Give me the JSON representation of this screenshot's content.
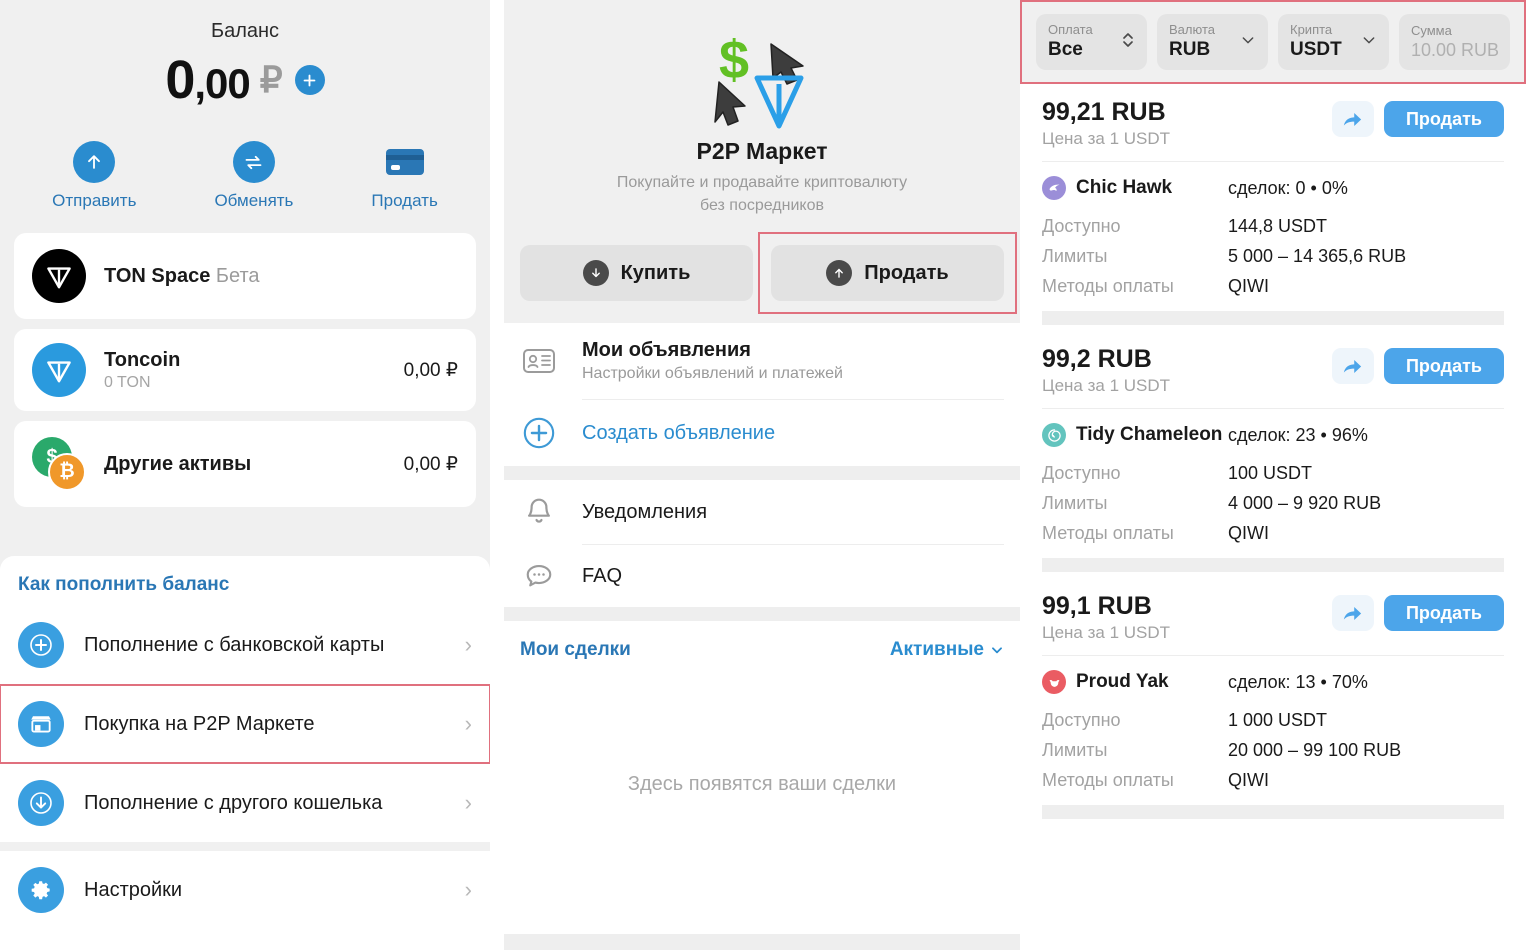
{
  "wallet": {
    "balance_label": "Баланс",
    "balance_int": "0",
    "balance_dec": ",00",
    "currency_symbol": "₽",
    "add_icon": "plus-icon",
    "actions": [
      {
        "label": "Отправить",
        "icon": "arrow-up-icon"
      },
      {
        "label": "Обменять",
        "icon": "swap-icon"
      },
      {
        "label": "Продать",
        "icon": "credit-card-icon"
      }
    ],
    "assets": [
      {
        "title": "TON Space",
        "badge": "Бета",
        "sub": "",
        "value": "",
        "icon": "ton-black-icon"
      },
      {
        "title": "Toncoin",
        "badge": "",
        "sub": "0 TON",
        "value": "0,00 ₽",
        "icon": "ton-blue-icon"
      },
      {
        "title": "Другие активы",
        "badge": "",
        "sub": "",
        "value": "0,00 ₽",
        "icon": "dual-coin-icon"
      }
    ],
    "howto_title": "Как пополнить баланс",
    "howto_items": [
      {
        "label": "Пополнение с банковской карты",
        "icon": "plus-circle-icon",
        "highlighted": false
      },
      {
        "label": "Покупка на P2P Маркете",
        "icon": "shop-icon",
        "highlighted": true
      },
      {
        "label": "Пополнение с другого кошелька",
        "icon": "arrow-down-icon",
        "highlighted": false
      }
    ],
    "settings_item": {
      "label": "Настройки",
      "icon": "gear-icon"
    }
  },
  "p2p": {
    "title": "P2P Маркет",
    "subtitle_line1": "Покупайте и продавайте криптовалюту",
    "subtitle_line2": "без посредников",
    "buy_label": "Купить",
    "sell_label": "Продать",
    "menu": [
      {
        "title": "Мои объявления",
        "sub": "Настройки объявлений и платежей",
        "icon": "id-card-icon",
        "style": "bold"
      },
      {
        "title": "Создать объявление",
        "sub": "",
        "icon": "plus-outline-icon",
        "style": "link"
      }
    ],
    "menu2": [
      {
        "title": "Уведомления",
        "sub": "",
        "icon": "bell-icon",
        "style": "plain"
      },
      {
        "title": "FAQ",
        "sub": "",
        "icon": "chat-icon",
        "style": "plain"
      }
    ],
    "deals_title": "Мои сделки",
    "deals_filter": "Активные",
    "deals_empty": "Здесь появятся ваши сделки"
  },
  "filters": [
    {
      "label": "Оплата",
      "value": "Все",
      "icon": "updown-chevron-icon",
      "muted": false
    },
    {
      "label": "Валюта",
      "value": "RUB",
      "icon": "chevron-down-icon",
      "muted": false
    },
    {
      "label": "Крипта",
      "value": "USDT",
      "icon": "chevron-down-icon",
      "muted": false
    },
    {
      "label": "Сумма",
      "value": "10.00 RUB",
      "icon": "",
      "muted": true
    }
  ],
  "offer_labels": {
    "price_sub": "Цена за 1 USDT",
    "available": "Доступно",
    "limits": "Лимиты",
    "payment_methods": "Методы оплаты",
    "sell_button": "Продать",
    "share_icon": "share-icon"
  },
  "offers": [
    {
      "price": "99,21 RUB",
      "price_sub": "Цена за 1 USDT",
      "trader": "Chic Hawk",
      "avatar_color": "#9b8ed8",
      "stats": "сделок: 0 • 0%",
      "available": "144,8 USDT",
      "limits": "5 000 – 14 365,6 RUB",
      "methods": "QIWI",
      "sell_button": "Продать"
    },
    {
      "price": "99,2 RUB",
      "price_sub": "Цена за 1 USDT",
      "trader": "Tidy Chameleon",
      "avatar_color": "#63c4be",
      "stats": "сделок: 23 • 96%",
      "available": "100 USDT",
      "limits": "4 000 – 9 920 RUB",
      "methods": "QIWI",
      "sell_button": "Продать"
    },
    {
      "price": "99,1 RUB",
      "price_sub": "Цена за 1 USDT",
      "trader": "Proud Yak",
      "avatar_color": "#ea5c63",
      "stats": "сделок: 13 • 70%",
      "available": "1 000 USDT",
      "limits": "20 000 – 99 100 RUB",
      "methods": "QIWI",
      "sell_button": "Продать"
    }
  ],
  "colors": {
    "accent_blue": "#2a8ccf",
    "button_blue": "#4ca5ea",
    "highlight_red": "#e0707e",
    "panel_gray": "#f0f0f0"
  }
}
